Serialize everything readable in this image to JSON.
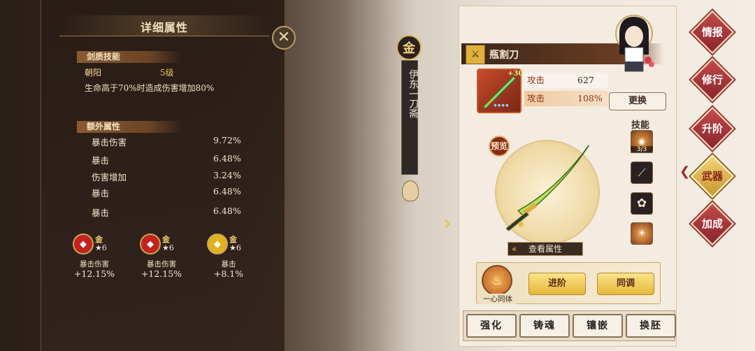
{
  "panel": {
    "title": "详细属性",
    "close_icon": "✕"
  },
  "sword_skill": {
    "header": "剑质技能",
    "name": "朝阳",
    "level": "5级",
    "desc": "生命高于70%时造成伤害增加80%"
  },
  "extra_attrs": {
    "header": "额外属性",
    "rows": [
      {
        "label": "暴击伤害",
        "value": "9.72%"
      },
      {
        "label": "暴击",
        "value": "6.48%"
      },
      {
        "label": "伤害增加",
        "value": "3.24%"
      },
      {
        "label": "暴击",
        "value": "6.48%"
      },
      {
        "label": "暴击",
        "value": "6.48%"
      }
    ]
  },
  "gems": [
    {
      "rank": "金",
      "stars": "★6",
      "name": "暴击伤害",
      "value": "+12.15%",
      "color": "#c3221e"
    },
    {
      "rank": "金",
      "stars": "★6",
      "name": "暴击伤害",
      "value": "+12.15%",
      "color": "#c3221e"
    },
    {
      "rank": "金",
      "stars": "★6",
      "name": "暴击",
      "value": "+8.1%",
      "color": "#e0b21e"
    }
  ],
  "character": {
    "rank": "金",
    "name": "伊东一刀斋"
  },
  "weapon": {
    "name": "瓶割刀",
    "level_badge": "+30",
    "stats": [
      {
        "label": "攻击",
        "value": "627"
      },
      {
        "label": "攻击",
        "value": "108%"
      }
    ],
    "replace_label": "更换",
    "preview_label": "预览",
    "view_attr_label": "查看属性"
  },
  "skills": {
    "title": "技能",
    "first_count": "3/3"
  },
  "bond": {
    "label": "一心同体",
    "advance_label": "进阶",
    "tune_label": "同调"
  },
  "bottom_actions": [
    "强化",
    "铸魂",
    "镶嵌",
    "换胚"
  ],
  "side_nav": [
    "情报",
    "修行",
    "升阶",
    "武器",
    "加成"
  ],
  "colors": {
    "accent_red": "#8a2430",
    "accent_gold": "#e6b83a"
  }
}
